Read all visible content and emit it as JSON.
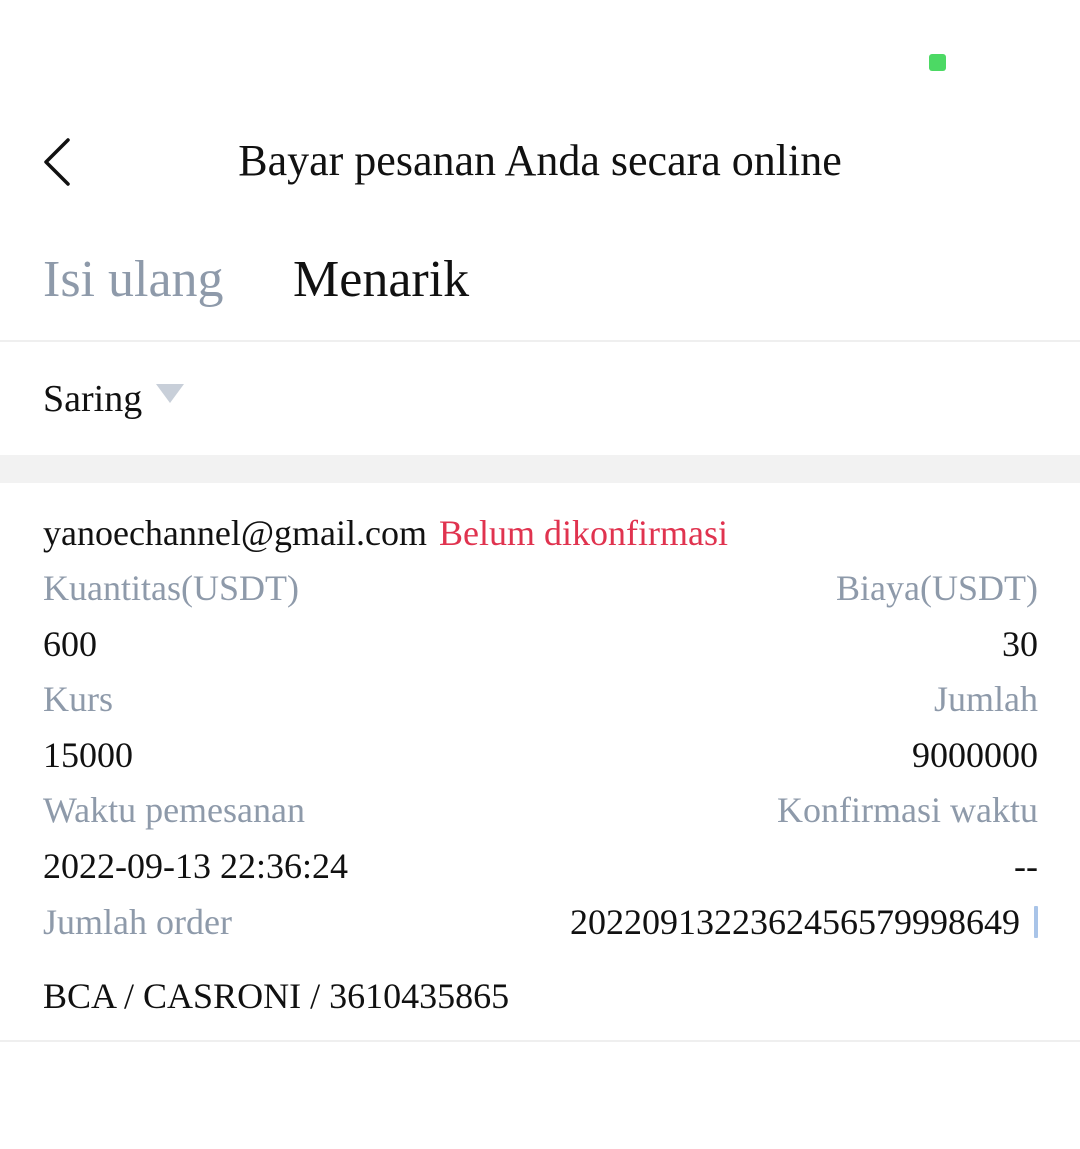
{
  "colors": {
    "status_green": "#4cd964",
    "pending_red": "#e0334f",
    "muted_label": "#8e9aaa",
    "text": "#111111"
  },
  "header": {
    "back_icon": "chevron-left-icon",
    "title": "Bayar pesanan Anda secara online"
  },
  "tabs": [
    {
      "label": "Isi ulang",
      "active": false
    },
    {
      "label": "Menarik",
      "active": true
    }
  ],
  "filter": {
    "label": "Saring",
    "icon": "caret-down-icon"
  },
  "record": {
    "email": "yanoechannel@gmail.com",
    "status": "Belum dikonfirmasi",
    "quantity_label": "Kuantitas(USDT)",
    "quantity_value": "600",
    "fee_label": "Biaya(USDT)",
    "fee_value": "30",
    "rate_label": "Kurs",
    "rate_value": "15000",
    "amount_label": "Jumlah",
    "amount_value": "9000000",
    "order_time_label": "Waktu pemesanan",
    "order_time_value": "2022-09-13 22:36:24",
    "confirm_time_label": "Konfirmasi waktu",
    "confirm_time_value": "--",
    "order_no_label": "Jumlah order",
    "order_no_value": "202209132236245657999864​9",
    "bank_info": "BCA / CASRONI / 3610435865"
  }
}
